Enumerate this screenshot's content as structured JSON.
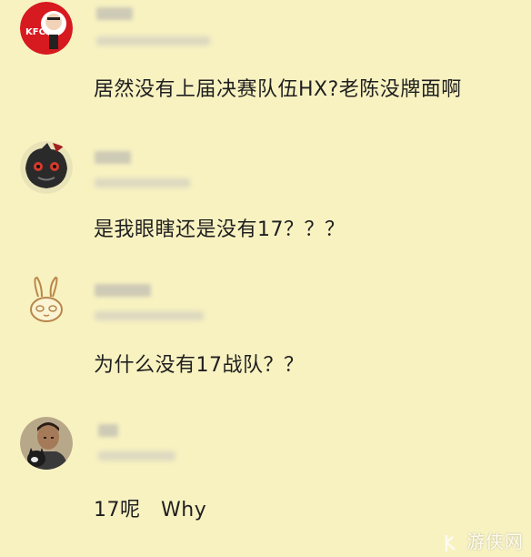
{
  "comments": [
    {
      "avatar": "kfc-logo-avatar",
      "text": "居然没有上届决赛队伍HX?老陈没牌面啊"
    },
    {
      "avatar": "dark-cat-avatar",
      "text": "是我眼瞎还是没有17？？？"
    },
    {
      "avatar": "bunny-doodle-avatar",
      "text": "为什么没有17战队？？"
    },
    {
      "avatar": "person-with-cat-avatar",
      "text": "17呢　Why"
    }
  ],
  "watermark": {
    "text": "游侠网",
    "icon": "ali213-logo-icon"
  },
  "colors": {
    "background": "#f8f2c1",
    "text": "#1f1f1f",
    "kfc_red": "#d71920"
  }
}
